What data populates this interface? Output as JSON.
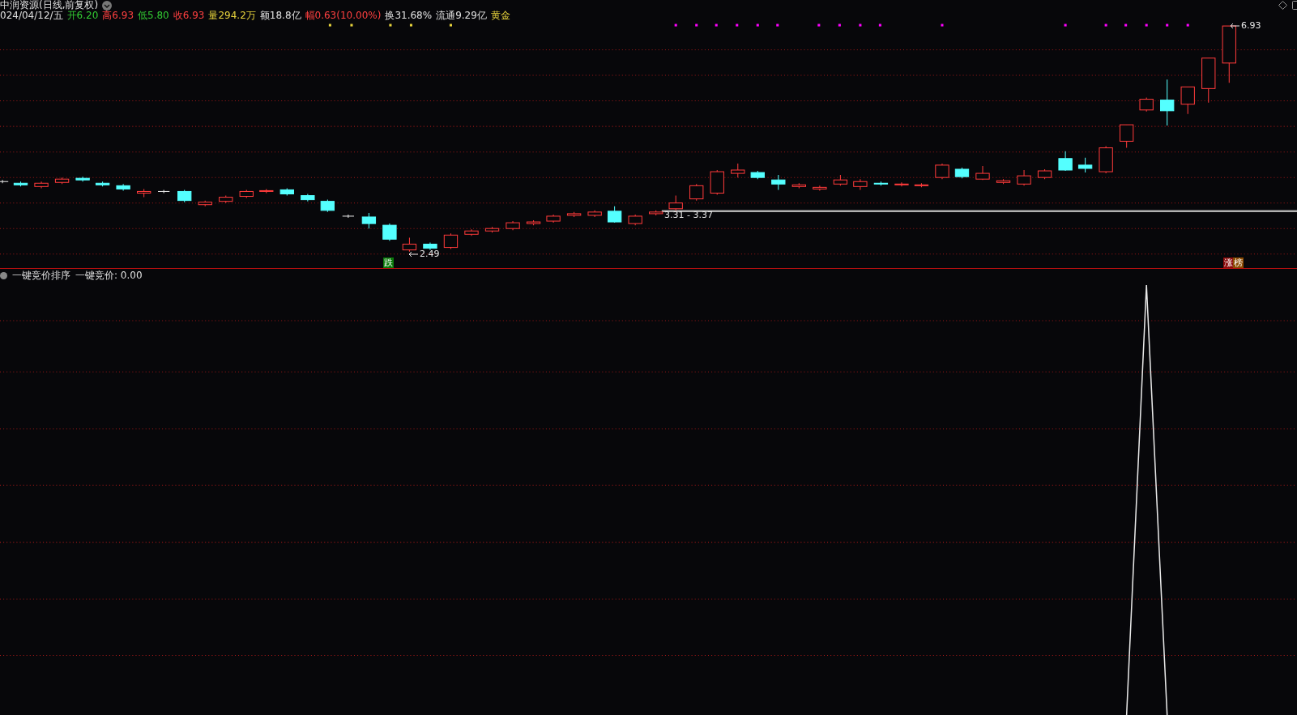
{
  "title": "中润资源(日线,前复权)",
  "quote": {
    "date": "024/04/12/五",
    "items": [
      {
        "label": "开",
        "value": "6.20",
        "color": "#33cc33"
      },
      {
        "label": "高",
        "value": "6.93",
        "color": "#ff4040"
      },
      {
        "label": "低",
        "value": "5.80",
        "color": "#33cc33"
      },
      {
        "label": "收",
        "value": "6.93",
        "color": "#ff4040"
      },
      {
        "label": "量",
        "value": "294.2万",
        "color": "#e6d23c"
      },
      {
        "label": "额",
        "value": "18.8亿",
        "color": "#e0e0e0"
      },
      {
        "label": "幅",
        "value": "0.63(10.00%)",
        "color": "#ff4040"
      },
      {
        "label": "换",
        "value": "31.68%",
        "color": "#e0e0e0"
      },
      {
        "label": "流通",
        "value": "9.29亿",
        "color": "#e0e0e0"
      }
    ],
    "tag": "黄金"
  },
  "chart_labels": [
    {
      "kind": "high",
      "text": "6.93"
    },
    {
      "kind": "low",
      "text": "2.49"
    },
    {
      "kind": "range",
      "text": "3.31 - 3.37"
    }
  ],
  "badges": [
    {
      "text": "跌",
      "color": "#0a7a0a"
    },
    {
      "text": "涨",
      "color": "#8a0a0a"
    },
    {
      "text": "榜",
      "color": "#8a4a00"
    }
  ],
  "indicator": {
    "name": "一键竞价排序",
    "reading": "一键竞价: 0.00"
  }
}
